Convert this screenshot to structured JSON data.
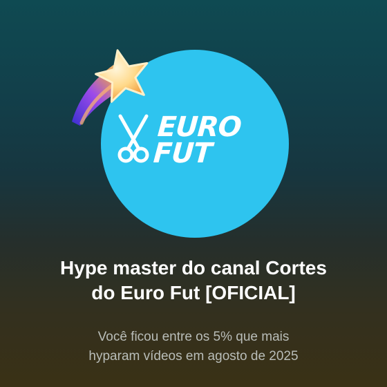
{
  "badge": {
    "logo_line1": "EURO",
    "logo_line2": "FUT",
    "avatar_color": "#2ec4ef",
    "icon": "shooting-star-icon"
  },
  "title": {
    "line1": "Hype master do canal Cortes",
    "line2": "do Euro Fut [OFICIAL]"
  },
  "subtitle": {
    "line1": "Você ficou entre os 5% que mais",
    "line2": "hyparam vídeos em agosto de 2025"
  }
}
